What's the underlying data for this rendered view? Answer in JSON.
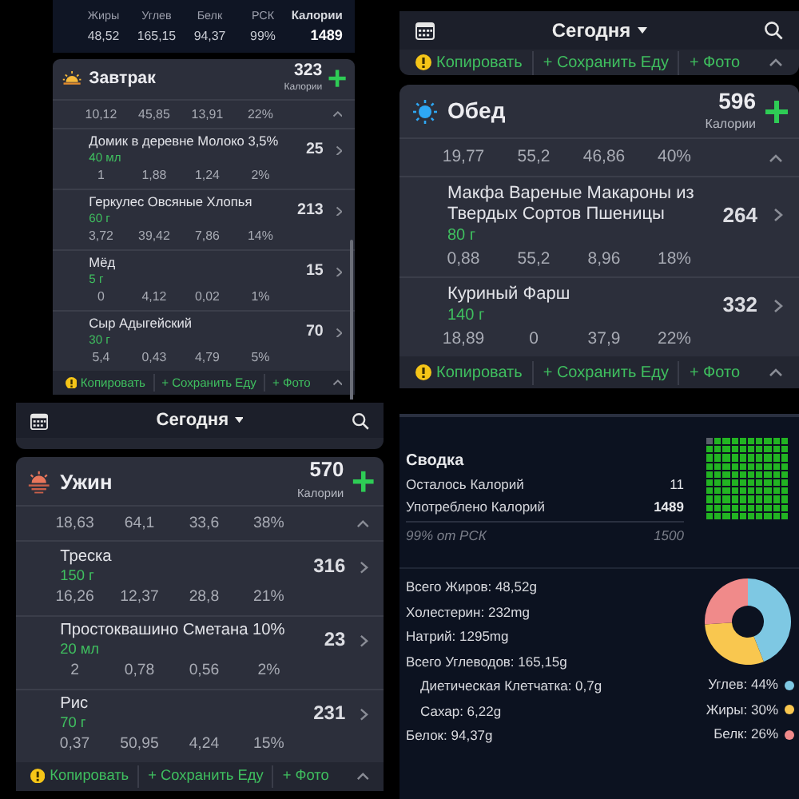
{
  "panels": [
    {
      "kind": "diary",
      "totals": {
        "columns": [
          {
            "label": "Жиры",
            "value": "48,52"
          },
          {
            "label": "Углев",
            "value": "165,15"
          },
          {
            "label": "Белк",
            "value": "94,37"
          },
          {
            "label": "РСК",
            "value": "99%"
          }
        ],
        "calories": {
          "label": "Калории",
          "value": "1489"
        }
      },
      "meal": {
        "name": "Завтрак",
        "calories": "323",
        "calories_label": "Калории",
        "expanded": true,
        "subtotals": [
          "10,12",
          "45,85",
          "13,91",
          "22%"
        ],
        "items": [
          {
            "name": "Домик в деревне Молоко 3,5%",
            "amount": "40 мл",
            "calories": "25",
            "values": [
              "1",
              "1,88",
              "1,24",
              "2%"
            ]
          },
          {
            "name": "Геркулес Овсяные Хлопья",
            "amount": "60 г",
            "calories": "213",
            "values": [
              "3,72",
              "39,42",
              "7,86",
              "14%"
            ]
          },
          {
            "name": "Мёд",
            "amount": "5 г",
            "calories": "15",
            "values": [
              "0",
              "4,12",
              "0,02",
              "1%"
            ]
          },
          {
            "name": "Сыр Адыгейский",
            "amount": "30 г",
            "calories": "70",
            "values": [
              "5,4",
              "0,43",
              "4,79",
              "5%"
            ]
          }
        ],
        "footer": [
          {
            "kind": "copy",
            "label": "Копировать"
          },
          {
            "kind": "save",
            "label": "+ Сохранить Еду"
          },
          {
            "kind": "photo",
            "label": "+ Фото"
          }
        ]
      }
    },
    {
      "kind": "diary",
      "top_bar": {
        "title": "Сегодня"
      },
      "previous_footer": [
        {
          "kind": "copy",
          "label": "Копировать"
        },
        {
          "kind": "save",
          "label": "+ Сохранить Еду"
        },
        {
          "kind": "photo",
          "label": "+ Фото"
        }
      ],
      "meal": {
        "name": "Обед",
        "calories": "596",
        "calories_label": "Калории",
        "expanded": true,
        "subtotals": [
          "19,77",
          "55,2",
          "46,86",
          "40%"
        ],
        "items": [
          {
            "name": "Макфа Вареные Макароны из Твердых Сортов Пшеницы",
            "amount": "80 г",
            "calories": "264",
            "values": [
              "0,88",
              "55,2",
              "8,96",
              "18%"
            ]
          },
          {
            "name": "Куриный Фарш",
            "amount": "140 г",
            "calories": "332",
            "values": [
              "18,89",
              "0",
              "37,9",
              "22%"
            ]
          }
        ],
        "footer": [
          {
            "kind": "copy",
            "label": "Копировать"
          },
          {
            "kind": "save",
            "label": "+ Сохранить Еду"
          },
          {
            "kind": "photo",
            "label": "+ Фото"
          }
        ]
      }
    },
    {
      "kind": "diary",
      "top_bar": {
        "title": "Сегодня"
      },
      "meal": {
        "name": "Ужин",
        "calories": "570",
        "calories_label": "Калории",
        "expanded": true,
        "subtotals": [
          "18,63",
          "64,1",
          "33,6",
          "38%"
        ],
        "items": [
          {
            "name": "Треска",
            "amount": "150 г",
            "calories": "316",
            "values": [
              "16,26",
              "12,37",
              "28,8",
              "21%"
            ]
          },
          {
            "name": "Простоквашино Сметана 10%",
            "amount": "20 мл",
            "calories": "23",
            "values": [
              "2",
              "0,78",
              "0,56",
              "2%"
            ]
          },
          {
            "name": "Рис",
            "amount": "70 г",
            "calories": "231",
            "values": [
              "0,37",
              "50,95",
              "4,24",
              "15%"
            ]
          }
        ],
        "footer": [
          {
            "kind": "copy",
            "label": "Копировать"
          },
          {
            "kind": "save",
            "label": "+ Сохранить Еду"
          },
          {
            "kind": "photo",
            "label": "+ Фото"
          }
        ]
      }
    },
    {
      "kind": "summary",
      "title": "Сводка",
      "rows": [
        {
          "label": "Осталось Калорий",
          "value": "11",
          "bold": false
        },
        {
          "label": "Употреблено Калорий",
          "value": "1489",
          "bold": true
        }
      ],
      "goal": {
        "label": "99% от РСК",
        "value": "1500"
      },
      "nutrients": [
        {
          "text": "Всего Жиров: 48,52g"
        },
        {
          "text": "Холестерин: 232mg"
        },
        {
          "text": "Натрий: 1295mg"
        },
        {
          "text": "Всего Углеводов: 165,15g",
          "children": [
            {
              "text": "Диетическая Клетчатка: 0,7g"
            },
            {
              "text": "Сахар: 6,22g"
            }
          ]
        },
        {
          "text": "Белок: 94,37g"
        }
      ],
      "chart_data": {
        "type": "donut",
        "categories": [
          "Углев: 44%",
          "Жиры: 30%",
          "Белк: 26%"
        ],
        "values": [
          44,
          30,
          26
        ]
      },
      "legend": [
        {
          "color": "#7ec8e3"
        },
        {
          "color": "#f9c74f"
        },
        {
          "color": "#f08a8a"
        }
      ]
    }
  ]
}
